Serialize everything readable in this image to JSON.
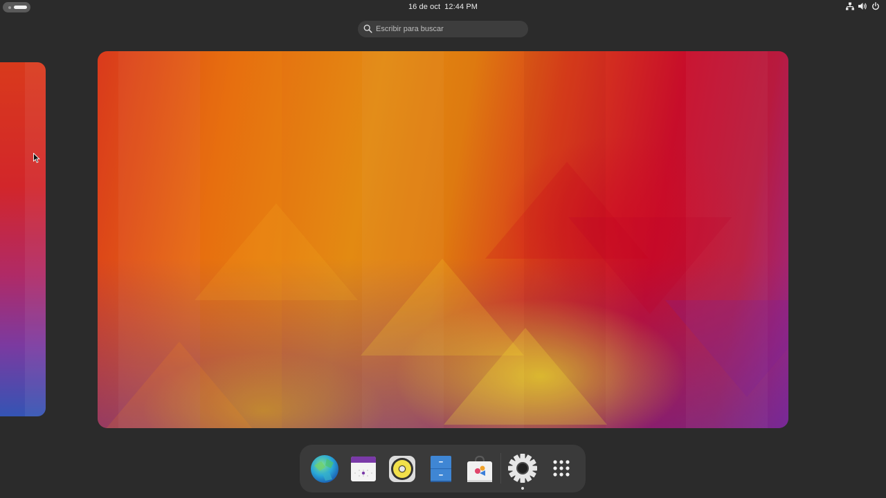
{
  "topbar": {
    "date": "16 de oct",
    "time": "12:44 PM",
    "status_icons": [
      "network-icon",
      "volume-icon",
      "power-icon"
    ]
  },
  "search": {
    "placeholder": "Escribir para buscar"
  },
  "dash": {
    "apps": [
      {
        "name": "web-browser",
        "icon": "globe-icon"
      },
      {
        "name": "calendar",
        "icon": "calendar-icon"
      },
      {
        "name": "music-player",
        "icon": "speaker-icon"
      },
      {
        "name": "files",
        "icon": "file-cabinet-icon"
      },
      {
        "name": "software",
        "icon": "shopping-bag-icon"
      },
      {
        "name": "settings",
        "icon": "gear-icon",
        "running": true
      },
      {
        "name": "show-apps",
        "icon": "app-grid-icon"
      }
    ]
  },
  "colors": {
    "panel_bg": "#2b2b2b",
    "dash_bg": "#3a3a3a",
    "search_bg": "#3d3d3d",
    "text": "#ededed"
  }
}
